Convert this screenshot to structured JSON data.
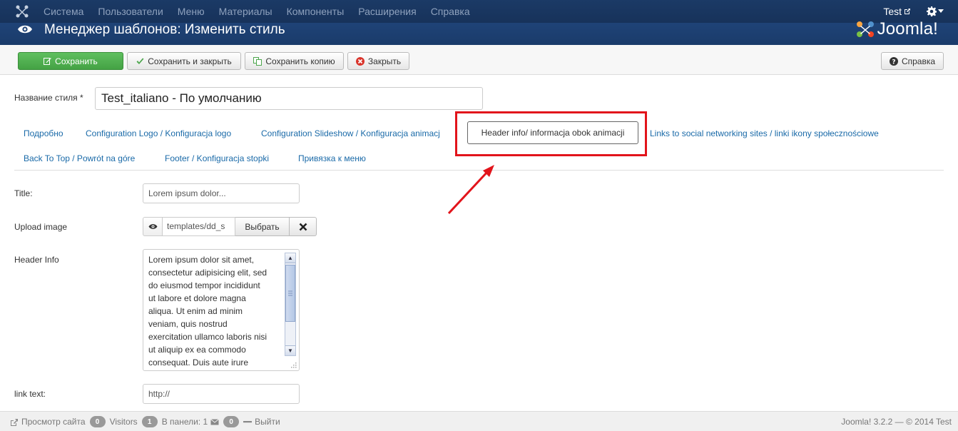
{
  "navbar": {
    "menu": [
      "Система",
      "Пользователи",
      "Меню",
      "Материалы",
      "Компоненты",
      "Расширения",
      "Справка"
    ],
    "user_label": "Test"
  },
  "header": {
    "title": "Менеджер шаблонов: Изменить стиль",
    "brand": "Joomla!"
  },
  "toolbar": {
    "save": "Сохранить",
    "save_close": "Сохранить и закрыть",
    "save_copy": "Сохранить копию",
    "close": "Закрыть",
    "help": "Справка"
  },
  "form": {
    "style_name_label": "Название стиля *",
    "style_name_value": "Test_italiano - По умолчанию"
  },
  "tabs": [
    "Подробно",
    "Configuration Logo / Konfiguracja logo",
    "Configuration Slideshow / Konfiguracja animacj",
    "Header info/ informacja obok animacji",
    "Links to social networking sites / linki ikony społecznościowe",
    "Back To Top / Powrót na góre",
    "Footer / Konfiguracja stopki",
    "Привязка к меню"
  ],
  "fields": {
    "title_label": "Title:",
    "title_value": "Lorem ipsum dolor...",
    "upload_label": "Upload image",
    "upload_path": "templates/dd_s",
    "upload_select": "Выбрать",
    "header_info_label": "Header Info",
    "header_info_value": "Lorem ipsum dolor sit amet,\nconsectetur adipisicing elit, sed\ndo eiusmod tempor incididunt\nut labore et dolore magna\naliqua. Ut enim ad minim\nveniam, quis nostrud\nexercitation ullamco laboris nisi\nut aliquip ex ea commodo\nconsequat. Duis aute irure",
    "link_text_label": "link text:",
    "link_text_value": "http://"
  },
  "statusbar": {
    "view_site": "Просмотр сайта",
    "visitors_count": "0",
    "visitors_label": "Visitors",
    "admin_count": "1",
    "admin_label": "В панели: 1",
    "messages_count": "0",
    "logout": "Выйти",
    "version": "Joomla! 3.2.2 — © 2014 Test"
  },
  "colors": {
    "navbar": "#17325a",
    "header": "#1f4377",
    "success": "#4cae4c",
    "link": "#1a6aa8",
    "highlight": "#e2141b"
  }
}
